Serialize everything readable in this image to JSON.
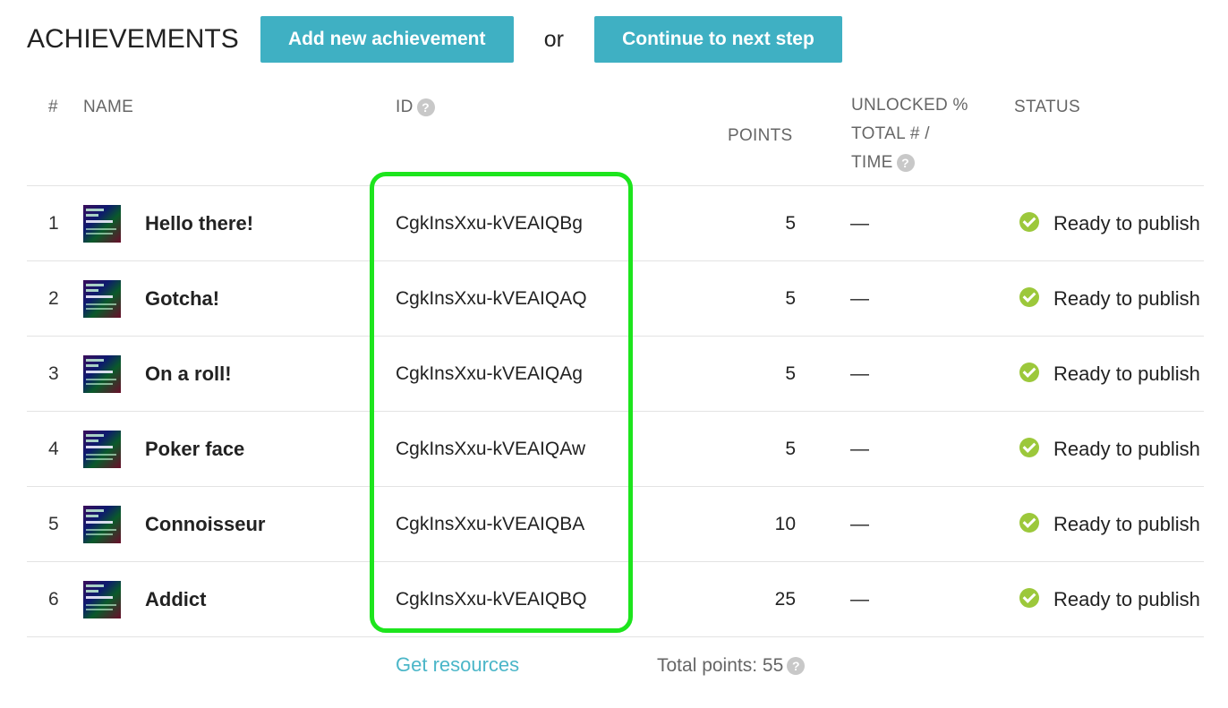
{
  "header": {
    "title": "ACHIEVEMENTS",
    "add_button": "Add new achievement",
    "or_text": "or",
    "continue_button": "Continue to next step"
  },
  "columns": {
    "num": "#",
    "name": "NAME",
    "id": "ID",
    "points": "POINTS",
    "unlocked_line1": "UNLOCKED %",
    "unlocked_line2": "TOTAL # /",
    "unlocked_line3": "TIME",
    "status": "STATUS",
    "help_glyph": "?"
  },
  "rows": [
    {
      "num": "1",
      "name": "Hello there!",
      "id": "CgkInsXxu-kVEAIQBg",
      "points": "5",
      "unlocked": "—",
      "status": "Ready to publish"
    },
    {
      "num": "2",
      "name": "Gotcha!",
      "id": "CgkInsXxu-kVEAIQAQ",
      "points": "5",
      "unlocked": "—",
      "status": "Ready to publish"
    },
    {
      "num": "3",
      "name": "On a roll!",
      "id": "CgkInsXxu-kVEAIQAg",
      "points": "5",
      "unlocked": "—",
      "status": "Ready to publish"
    },
    {
      "num": "4",
      "name": "Poker face",
      "id": "CgkInsXxu-kVEAIQAw",
      "points": "5",
      "unlocked": "—",
      "status": "Ready to publish"
    },
    {
      "num": "5",
      "name": "Connoisseur",
      "id": "CgkInsXxu-kVEAIQBA",
      "points": "10",
      "unlocked": "—",
      "status": "Ready to publish"
    },
    {
      "num": "6",
      "name": "Addict",
      "id": "CgkInsXxu-kVEAIQBQ",
      "points": "25",
      "unlocked": "—",
      "status": "Ready to publish"
    }
  ],
  "footer": {
    "resources_link": "Get resources",
    "total_points": "Total points: 55"
  },
  "colors": {
    "accent": "#3fb0c3",
    "highlight": "#1de51d",
    "status_ok": "#9cc83b",
    "link": "#4bb6c8"
  },
  "icons": {
    "help": "help-circle-icon",
    "status": "check-circle-icon",
    "thumbnail": "achievement-image"
  }
}
